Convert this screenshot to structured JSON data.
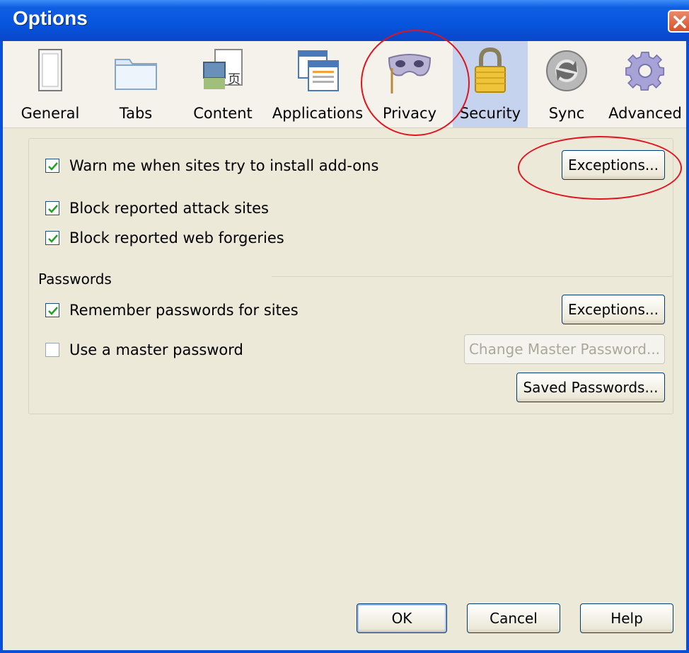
{
  "window": {
    "title": "Options"
  },
  "toolbar": {
    "items": [
      {
        "label": "General",
        "icon": "general-icon"
      },
      {
        "label": "Tabs",
        "icon": "tabs-icon"
      },
      {
        "label": "Content",
        "icon": "content-icon"
      },
      {
        "label": "Applications",
        "icon": "applications-icon"
      },
      {
        "label": "Privacy",
        "icon": "privacy-mask-icon"
      },
      {
        "label": "Security",
        "icon": "padlock-icon",
        "selected": true
      },
      {
        "label": "Sync",
        "icon": "sync-icon"
      },
      {
        "label": "Advanced",
        "icon": "gear-icon"
      }
    ]
  },
  "security": {
    "warn_addons": {
      "label": "Warn me when sites try to install add-ons",
      "checked": true
    },
    "addons_exceptions_label": "Exceptions...",
    "block_attack": {
      "label": "Block reported attack sites",
      "checked": true
    },
    "block_forgeries": {
      "label": "Block reported web forgeries",
      "checked": true
    }
  },
  "passwords": {
    "section_label": "Passwords",
    "remember": {
      "label": "Remember passwords for sites",
      "checked": true
    },
    "exceptions_label": "Exceptions...",
    "master": {
      "label": "Use a master password",
      "checked": false
    },
    "change_master_label": "Change Master Password...",
    "saved_label": "Saved Passwords..."
  },
  "footer": {
    "ok": "OK",
    "cancel": "Cancel",
    "help": "Help"
  },
  "colors": {
    "annotation": "#e0141e",
    "titlebar": "#0754dd",
    "selected_tab": "#c5d3ef"
  }
}
